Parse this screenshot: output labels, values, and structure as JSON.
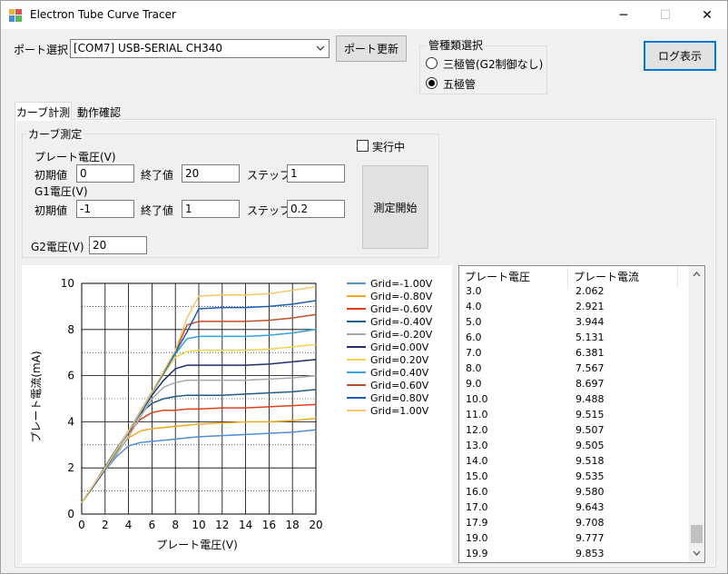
{
  "window": {
    "title": "Electron Tube Curve Tracer",
    "minimize_glyph": "─",
    "maximize_glyph": "☐",
    "close_glyph": "✕"
  },
  "port": {
    "label": "ポート選択",
    "selected": "[COM7] USB-SERIAL CH340",
    "refresh_button": "ポート更新"
  },
  "tube_type": {
    "group_title": "管種類選択",
    "options": [
      {
        "label": "三極管(G2制御なし)",
        "selected": false
      },
      {
        "label": "五極管",
        "selected": true
      }
    ]
  },
  "log_button": "ログ表示",
  "tabs": [
    {
      "label": "カーブ計測",
      "active": true
    },
    {
      "label": "動作確認",
      "active": false
    }
  ],
  "measure": {
    "group_title": "カーブ測定",
    "running_label": "実行中",
    "running_checked": false,
    "plate_voltage_label": "プレート電圧(V)",
    "g1_voltage_label": "G1電圧(V)",
    "g2_voltage_label": "G2電圧(V)",
    "start_label": "初期値",
    "end_label": "終了値",
    "step_label": "ステップ",
    "plate": {
      "start": "0",
      "end": "20",
      "step": "1"
    },
    "g1": {
      "start": "-1",
      "end": "1",
      "step": "0.2"
    },
    "g2": "20",
    "start_button": "測定開始"
  },
  "chart_data": {
    "type": "line",
    "title": "",
    "xlabel": "プレート電圧(V)",
    "ylabel": "プレート電流(mA)",
    "xlim": [
      0,
      20
    ],
    "ylim": [
      0,
      10
    ],
    "xticks": [
      "0",
      "2",
      "4",
      "6",
      "8",
      "10",
      "12",
      "14",
      "16",
      "18",
      "20"
    ],
    "yticks": [
      "0",
      "2",
      "4",
      "6",
      "8",
      "10"
    ],
    "grid": true,
    "legend_position": "right",
    "series": [
      {
        "name": "Grid=-1.00V",
        "color": "#4f8fd6",
        "x": [
          0,
          1,
          2,
          3,
          4,
          5,
          6,
          7,
          8,
          9,
          10,
          12,
          14,
          16,
          18,
          20
        ],
        "y": [
          0.5,
          1.2,
          1.9,
          2.5,
          2.95,
          3.1,
          3.15,
          3.2,
          3.25,
          3.3,
          3.35,
          3.4,
          3.45,
          3.5,
          3.55,
          3.65
        ]
      },
      {
        "name": "Grid=-0.80V",
        "color": "#f5a623",
        "x": [
          0,
          1,
          2,
          3,
          4,
          5,
          6,
          7,
          8,
          9,
          10,
          12,
          14,
          16,
          18,
          20
        ],
        "y": [
          0.5,
          1.2,
          1.95,
          2.7,
          3.3,
          3.6,
          3.7,
          3.75,
          3.8,
          3.85,
          3.9,
          3.95,
          4.0,
          4.0,
          4.05,
          4.15
        ]
      },
      {
        "name": "Grid=-0.60V",
        "color": "#e0401a",
        "x": [
          0,
          1,
          2,
          3,
          4,
          5,
          6,
          7,
          8,
          9,
          10,
          12,
          14,
          16,
          18,
          20
        ],
        "y": [
          0.5,
          1.2,
          2.0,
          2.8,
          3.5,
          4.1,
          4.4,
          4.5,
          4.5,
          4.55,
          4.55,
          4.6,
          4.6,
          4.65,
          4.7,
          4.75
        ]
      },
      {
        "name": "Grid=-0.40V",
        "color": "#1f5d8a",
        "x": [
          0,
          1,
          2,
          3,
          4,
          5,
          6,
          7,
          8,
          9,
          10,
          12,
          14,
          16,
          18,
          20
        ],
        "y": [
          0.5,
          1.25,
          2.05,
          2.85,
          3.6,
          4.35,
          4.8,
          5.0,
          5.1,
          5.15,
          5.15,
          5.15,
          5.2,
          5.25,
          5.3,
          5.4
        ]
      },
      {
        "name": "Grid=-0.20V",
        "color": "#a8a8a8",
        "x": [
          0,
          1,
          2,
          3,
          4,
          5,
          6,
          7,
          8,
          9,
          10,
          12,
          14,
          16,
          18,
          20
        ],
        "y": [
          0.5,
          1.2,
          1.9,
          2.6,
          3.35,
          4.2,
          5.0,
          5.5,
          5.7,
          5.8,
          5.8,
          5.8,
          5.8,
          5.85,
          5.9,
          6.0
        ]
      },
      {
        "name": "Grid=0.00V",
        "color": "#1e2f6b",
        "x": [
          0,
          1,
          2,
          3,
          4,
          5,
          6,
          7,
          8,
          9,
          10,
          12,
          14,
          16,
          18,
          20
        ],
        "y": [
          0.5,
          1.2,
          1.95,
          2.75,
          3.55,
          4.35,
          5.15,
          5.8,
          6.3,
          6.45,
          6.45,
          6.45,
          6.45,
          6.5,
          6.6,
          6.7
        ]
      },
      {
        "name": "Grid=0.20V",
        "color": "#f2d24a",
        "x": [
          0,
          1,
          2,
          3,
          4,
          5,
          6,
          7,
          8,
          9,
          10,
          12,
          14,
          16,
          18,
          20
        ],
        "y": [
          0.5,
          1.25,
          2.0,
          2.8,
          3.6,
          4.4,
          5.25,
          6.05,
          6.8,
          7.05,
          7.1,
          7.1,
          7.1,
          7.15,
          7.25,
          7.35
        ]
      },
      {
        "name": "Grid=0.40V",
        "color": "#36a2e0",
        "x": [
          0,
          1,
          2,
          3,
          4,
          5,
          6,
          7,
          8,
          9,
          10,
          12,
          14,
          16,
          18,
          20
        ],
        "y": [
          0.5,
          1.2,
          1.95,
          2.75,
          3.55,
          4.4,
          5.25,
          6.1,
          6.95,
          7.6,
          7.7,
          7.7,
          7.7,
          7.75,
          7.85,
          8.0
        ]
      },
      {
        "name": "Grid=0.60V",
        "color": "#c0502a",
        "x": [
          0,
          1,
          2,
          3,
          4,
          5,
          6,
          7,
          8,
          9,
          10,
          12,
          14,
          16,
          18,
          20
        ],
        "y": [
          0.5,
          1.25,
          2.0,
          2.8,
          3.6,
          4.45,
          5.3,
          6.15,
          7.05,
          8.2,
          8.35,
          8.35,
          8.35,
          8.4,
          8.5,
          8.65
        ]
      },
      {
        "name": "Grid=0.80V",
        "color": "#1d5fb4",
        "x": [
          0,
          1,
          2,
          3,
          4,
          5,
          6,
          7,
          8,
          9,
          10,
          12,
          14,
          16,
          18,
          20
        ],
        "y": [
          0.5,
          1.2,
          1.95,
          2.8,
          3.6,
          4.45,
          5.3,
          6.15,
          7.0,
          7.9,
          8.9,
          8.95,
          8.95,
          9.0,
          9.1,
          9.25
        ]
      },
      {
        "name": "Grid=1.00V",
        "color": "#f6c667",
        "x": [
          0,
          1,
          2,
          3,
          4,
          5,
          6,
          7,
          8,
          9,
          10,
          12,
          14,
          16,
          18,
          20
        ],
        "y": [
          0.5,
          1.25,
          2.0,
          2.8,
          3.6,
          4.45,
          5.3,
          6.2,
          7.1,
          8.5,
          9.45,
          9.5,
          9.5,
          9.55,
          9.7,
          9.85
        ]
      }
    ]
  },
  "list": {
    "columns": [
      "プレート電圧",
      "プレート電流"
    ],
    "rows": [
      [
        "3.0",
        "2.062"
      ],
      [
        "4.0",
        "2.921"
      ],
      [
        "5.0",
        "3.944"
      ],
      [
        "6.0",
        "5.131"
      ],
      [
        "7.0",
        "6.381"
      ],
      [
        "8.0",
        "7.567"
      ],
      [
        "9.0",
        "8.697"
      ],
      [
        "10.0",
        "9.488"
      ],
      [
        "11.0",
        "9.515"
      ],
      [
        "12.0",
        "9.507"
      ],
      [
        "13.0",
        "9.505"
      ],
      [
        "14.0",
        "9.518"
      ],
      [
        "15.0",
        "9.535"
      ],
      [
        "16.0",
        "9.580"
      ],
      [
        "17.0",
        "9.643"
      ],
      [
        "17.9",
        "9.708"
      ],
      [
        "19.0",
        "9.777"
      ],
      [
        "19.9",
        "9.853"
      ]
    ]
  }
}
